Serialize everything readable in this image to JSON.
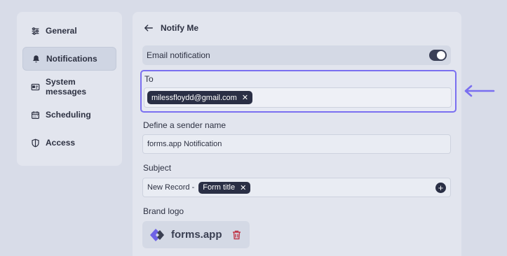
{
  "sidebar": {
    "items": [
      {
        "label": "General",
        "icon": "sliders-icon"
      },
      {
        "label": "Notifications",
        "icon": "bell-icon",
        "active": true
      },
      {
        "label": "System messages",
        "icon": "id-card-icon"
      },
      {
        "label": "Scheduling",
        "icon": "calendar-icon"
      },
      {
        "label": "Access",
        "icon": "shield-icon"
      }
    ]
  },
  "panel": {
    "title": "Notify Me",
    "email_toggle": {
      "label": "Email notification",
      "on": true
    },
    "to": {
      "label": "To",
      "chip": "milessfloydd@gmail.com"
    },
    "sender": {
      "label": "Define a sender name",
      "value": "forms.app Notification"
    },
    "subject": {
      "label": "Subject",
      "prefix": "New Record -",
      "chip": "Form title"
    },
    "brand_logo": {
      "label": "Brand logo",
      "logo_text": "forms.app"
    }
  },
  "colors": {
    "accent": "#7a6ff0",
    "chip": "#2a2f45"
  }
}
